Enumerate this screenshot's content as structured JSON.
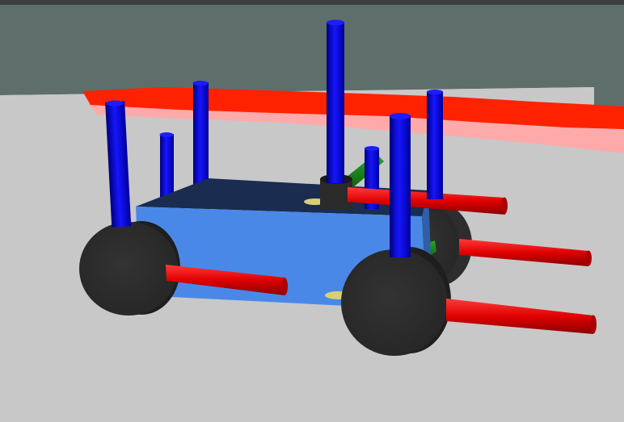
{
  "viewport": {
    "scene": "robot-3d-render",
    "colors": {
      "top_bar": "#3c3f41",
      "background_wall": "#5e6e6b",
      "ground": "#c8c8c8",
      "laser_scan": "#ff2200",
      "laser_scan_faded": "#ffaaaa",
      "chassis_front": "#4a88e8",
      "chassis_top": "#1a2c50",
      "wheel": "#2d2d2d",
      "axis_x": "#ee0000",
      "axis_y": "#118811",
      "axis_z": "#0a0ae6",
      "sensor": "#2a2a2a",
      "caster": "#cc2288",
      "yellow_marker": "#d8d070"
    }
  }
}
